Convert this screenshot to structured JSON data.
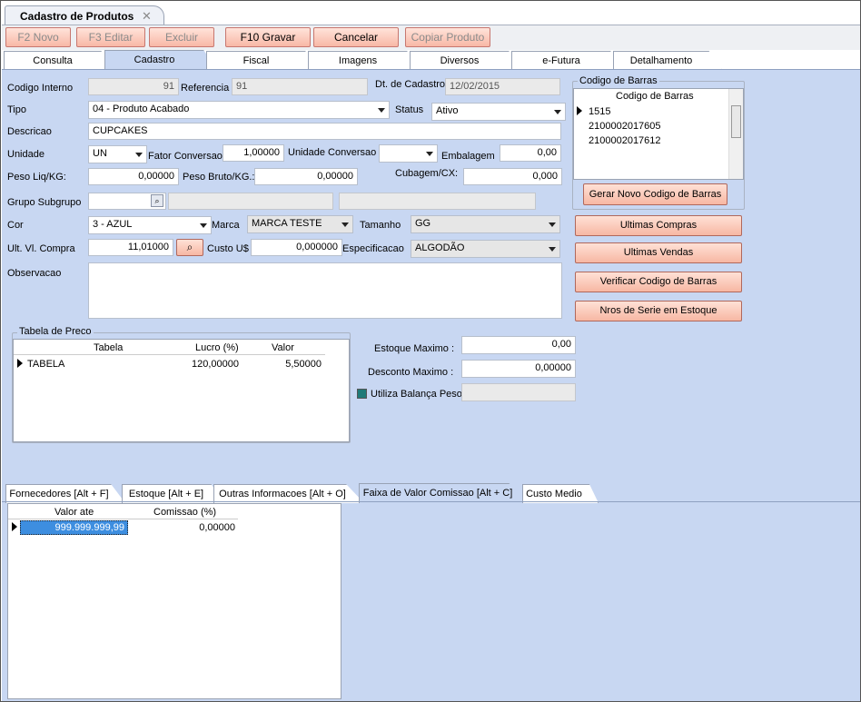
{
  "window": {
    "title": "Cadastro de Produtos"
  },
  "toolbar": {
    "novo": "F2 Novo",
    "editar": "F3 Editar",
    "excluir": "Excluir",
    "gravar": "F10 Gravar",
    "cancelar": "Cancelar",
    "copiar": "Copiar Produto"
  },
  "tabs": [
    "Consulta",
    "Cadastro",
    "Fiscal",
    "Imagens",
    "Diversos",
    "e-Futura",
    "Detalhamento"
  ],
  "form": {
    "codigo_interno": {
      "label": "Codigo Interno",
      "value": "91"
    },
    "referencia": {
      "label": "Referencia",
      "value": "91"
    },
    "dt_cadastro": {
      "label": "Dt. de Cadastro",
      "value": "12/02/2015"
    },
    "tipo": {
      "label": "Tipo",
      "value": "04 - Produto Acabado"
    },
    "status": {
      "label": "Status",
      "value": "Ativo"
    },
    "descricao": {
      "label": "Descricao",
      "value": "CUPCAKES"
    },
    "unidade": {
      "label": "Unidade",
      "value": "UN"
    },
    "fator_conversao": {
      "label": "Fator Conversao",
      "value": "1,00000"
    },
    "unidade_conversao": {
      "label": "Unidade Conversao",
      "value": ""
    },
    "embalagem": {
      "label": "Embalagem",
      "value": "0,00"
    },
    "peso_liq": {
      "label": "Peso Liq/KG:",
      "value": "0,00000"
    },
    "peso_bruto": {
      "label": "Peso Bruto/KG.:",
      "value": "0,00000"
    },
    "cubagem": {
      "label": "Cubagem/CX:",
      "value": "0,000"
    },
    "grupo_subgrupo": {
      "label": "Grupo Subgrupo",
      "value": ""
    },
    "cor": {
      "label": "Cor",
      "value": "3 - AZUL"
    },
    "marca": {
      "label": "Marca",
      "value": "MARCA TESTE"
    },
    "tamanho": {
      "label": "Tamanho",
      "value": "GG"
    },
    "ult_vl_compra": {
      "label": "Ult. Vl. Compra",
      "value": "11,01000"
    },
    "custo_us": {
      "label": "Custo U$",
      "value": "0,000000"
    },
    "especificacao": {
      "label": "Especificacao",
      "value": "ALGODÃO"
    },
    "observacao": {
      "label": "Observacao",
      "value": ""
    }
  },
  "codigo_barras": {
    "group_title": "Codigo de Barras",
    "header": "Codigo de Barras",
    "items": [
      "1515",
      "2100002017605",
      "2100002017612"
    ],
    "gerar_button": "Gerar Novo Codigo de Barras"
  },
  "side_buttons": {
    "ultimas_compras": "Ultimas Compras",
    "ultimas_vendas": "Ultimas Vendas",
    "verificar": "Verificar Codigo de Barras",
    "nros_serie": "Nros de Serie em Estoque"
  },
  "tabela_preco": {
    "title": "Tabela de Preco",
    "columns": [
      "Tabela",
      "Lucro (%)",
      "Valor"
    ],
    "rows": [
      {
        "tabela": "TABELA",
        "lucro": "120,00000",
        "valor": "5,50000"
      }
    ]
  },
  "estoque": {
    "estoque_maximo": {
      "label": "Estoque Maximo :",
      "value": "0,00"
    },
    "desconto_maximo": {
      "label": "Desconto Maximo :",
      "value": "0,00000"
    },
    "balanca": {
      "label": "Utiliza Balança Peso",
      "value": ""
    }
  },
  "bottom_tabs": [
    "Fornecedores [Alt + F]",
    "Estoque [Alt + E]",
    "Outras Informacoes [Alt + O]",
    "Faixa de Valor Comissao [Alt + C]",
    "Custo Medio"
  ],
  "comissao": {
    "columns": [
      "Valor ate",
      "Comissao (%)"
    ],
    "rows": [
      {
        "valor_ate": "999.999.999,99",
        "comissao": "0,00000"
      }
    ]
  },
  "colors": {
    "panel": "#c8d7f2",
    "button": "#f8b8a6",
    "selection": "#3d8ee0"
  }
}
